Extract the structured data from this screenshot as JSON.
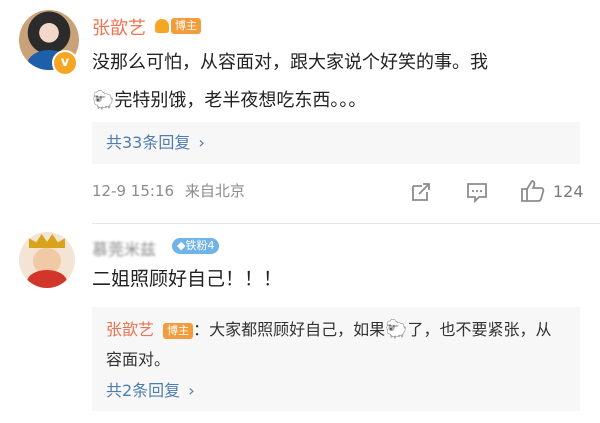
{
  "post": {
    "author": "张歆艺",
    "author_badge": "博主",
    "verify_mark": "v",
    "text_line1": "没那么可怕，从容面对，跟大家说个好笑的事。我",
    "text_line2_emoji": "🐑",
    "text_line2": "完特别饿，老半夜想吃东西。。。",
    "replies_more": "共33条回复",
    "replies_chevron": "›",
    "time": "12-9 15:16",
    "source": "来自北京",
    "like_count": "124"
  },
  "comment": {
    "author": "慕莞米兹",
    "fan_badge": "◆铁粉4",
    "text": "二姐照顾好自己！！！",
    "sub_reply": {
      "author": "张歆艺",
      "author_badge": "博主",
      "text_before": "：大家都照顾好自己，如果",
      "emoji": "🐑",
      "text_after": "了，也不要紧张，从容面对。",
      "more": "共2条回复",
      "chevron": "›"
    }
  },
  "colors": {
    "author_orange": "#eb7350",
    "link_blue": "#507daf",
    "meta_gray": "#8c8c8c",
    "badge_orange": "#f39c3e",
    "fan_badge_blue": "#6fb3e8"
  },
  "icons": [
    "share-icon",
    "comment-icon",
    "like-icon",
    "verified-v-icon",
    "medal-icon"
  ]
}
